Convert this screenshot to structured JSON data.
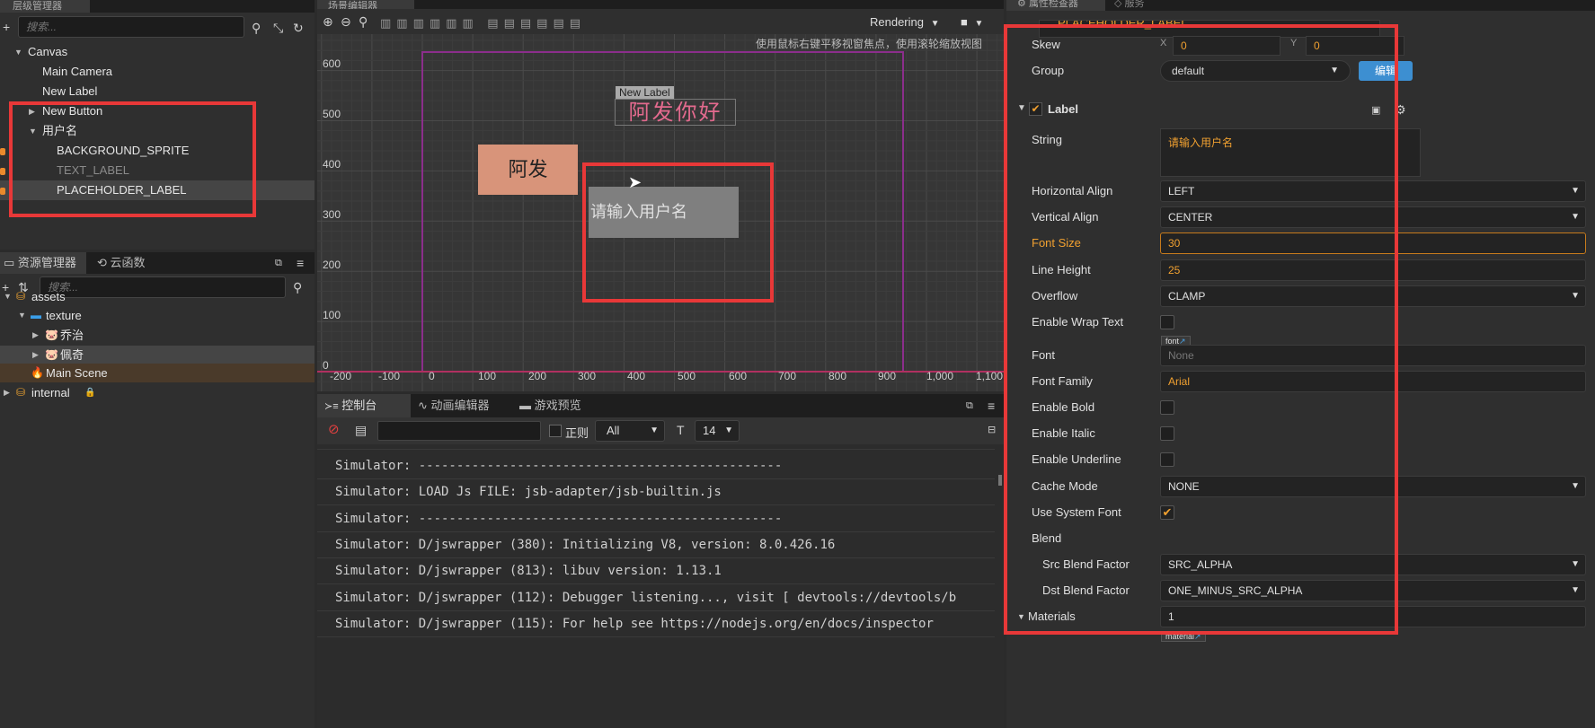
{
  "hierarchy": {
    "tab": "层级管理器",
    "search_placeholder": "搜索...",
    "nodes": [
      {
        "label": "Canvas",
        "indent": 0,
        "arrow": "▼"
      },
      {
        "label": "Main Camera",
        "indent": 1,
        "arrow": ""
      },
      {
        "label": "New Label",
        "indent": 1,
        "arrow": ""
      },
      {
        "label": "New Button",
        "indent": 1,
        "arrow": "▶"
      },
      {
        "label": "用户名",
        "indent": 1,
        "arrow": "▼"
      },
      {
        "label": "BACKGROUND_SPRITE",
        "indent": 2,
        "arrow": ""
      },
      {
        "label": "TEXT_LABEL",
        "indent": 2,
        "arrow": ""
      },
      {
        "label": "PLACEHOLDER_LABEL",
        "indent": 2,
        "arrow": ""
      }
    ]
  },
  "assets": {
    "tab": "资源管理器",
    "tab2": "云函数",
    "search_placeholder": "搜索...",
    "items": [
      {
        "label": "assets",
        "arrow": "▼"
      },
      {
        "label": "texture",
        "arrow": "▼"
      },
      {
        "label": "乔治",
        "arrow": "▶"
      },
      {
        "label": "佩奇",
        "arrow": "▶"
      },
      {
        "label": "Main Scene",
        "arrow": ""
      },
      {
        "label": "internal",
        "arrow": "▶"
      }
    ]
  },
  "scene": {
    "tab": "场景编辑器",
    "rendering": "Rendering",
    "hint": "使用鼠标右键平移视窗焦点，使用滚轮缩放视图",
    "y_ticks": [
      "600",
      "500",
      "400",
      "300",
      "200",
      "100",
      "0"
    ],
    "x_ticks": [
      "-200",
      "-100",
      "0",
      "100",
      "200",
      "300",
      "400",
      "500",
      "600",
      "700",
      "800",
      "900",
      "1,000",
      "1,100"
    ],
    "label_tag": "New Label",
    "label_text": "阿发你好",
    "button_text": "阿发",
    "input_text": "请输入用户名"
  },
  "console": {
    "tabs": [
      "控制台",
      "动画编辑器",
      "游戏预览"
    ],
    "regex_label": "正则",
    "level": "All",
    "font_size": "14",
    "lines": [
      "Simulator: ------------------------------------------------",
      "Simulator: LOAD Js FILE: jsb-adapter/jsb-builtin.js",
      "Simulator: ------------------------------------------------",
      "Simulator: D/jswrapper (380): Initializing V8, version: 8.0.426.16",
      "Simulator: D/jswrapper (813): libuv version: 1.13.1",
      "Simulator: D/jswrapper (112): Debugger listening..., visit [ devtools://devtools/b",
      "Simulator: D/jswrapper (115): For help see https://nodejs.org/en/docs/inspector"
    ]
  },
  "inspector": {
    "tab": "属性检查器",
    "tab2": "服务",
    "node_name": "PLACEHOLDER_LABEL",
    "skew_label": "Skew",
    "skew_x": "0",
    "skew_y": "0",
    "group_label": "Group",
    "group_value": "default",
    "edit_button": "编辑",
    "component": "Label",
    "string_label": "String",
    "string_value": "请输入用户名",
    "props": [
      {
        "label": "Horizontal Align",
        "type": "select",
        "value": "LEFT"
      },
      {
        "label": "Vertical Align",
        "type": "select",
        "value": "CENTER"
      },
      {
        "label": "Font Size",
        "type": "number",
        "value": "30",
        "highlight": true
      },
      {
        "label": "Line Height",
        "type": "number",
        "value": "25"
      },
      {
        "label": "Overflow",
        "type": "select",
        "value": "CLAMP"
      },
      {
        "label": "Enable Wrap Text",
        "type": "check",
        "value": "off"
      }
    ],
    "font_label": "Font",
    "font_tag": "font",
    "font_value": "None",
    "font_family_label": "Font Family",
    "font_family_value": "Arial",
    "props2": [
      {
        "label": "Enable Bold",
        "type": "check",
        "value": "off"
      },
      {
        "label": "Enable Italic",
        "type": "check",
        "value": "off"
      },
      {
        "label": "Enable Underline",
        "type": "check",
        "value": "off"
      },
      {
        "label": "Cache Mode",
        "type": "select",
        "value": "NONE"
      },
      {
        "label": "Use System Font",
        "type": "check",
        "value": "on"
      }
    ],
    "blend_label": "Blend",
    "src_blend_label": "Src Blend Factor",
    "src_blend_value": "SRC_ALPHA",
    "dst_blend_label": "Dst Blend Factor",
    "dst_blend_value": "ONE_MINUS_SRC_ALPHA",
    "materials_label": "Materials",
    "materials_value": "1",
    "material_tag": "material"
  },
  "colors": {
    "accent": "#f0a030",
    "highlight_red": "#e83838",
    "button_bg": "#d8947a",
    "input_bg": "#7f7f7f",
    "label_pink": "#e36a8e"
  }
}
